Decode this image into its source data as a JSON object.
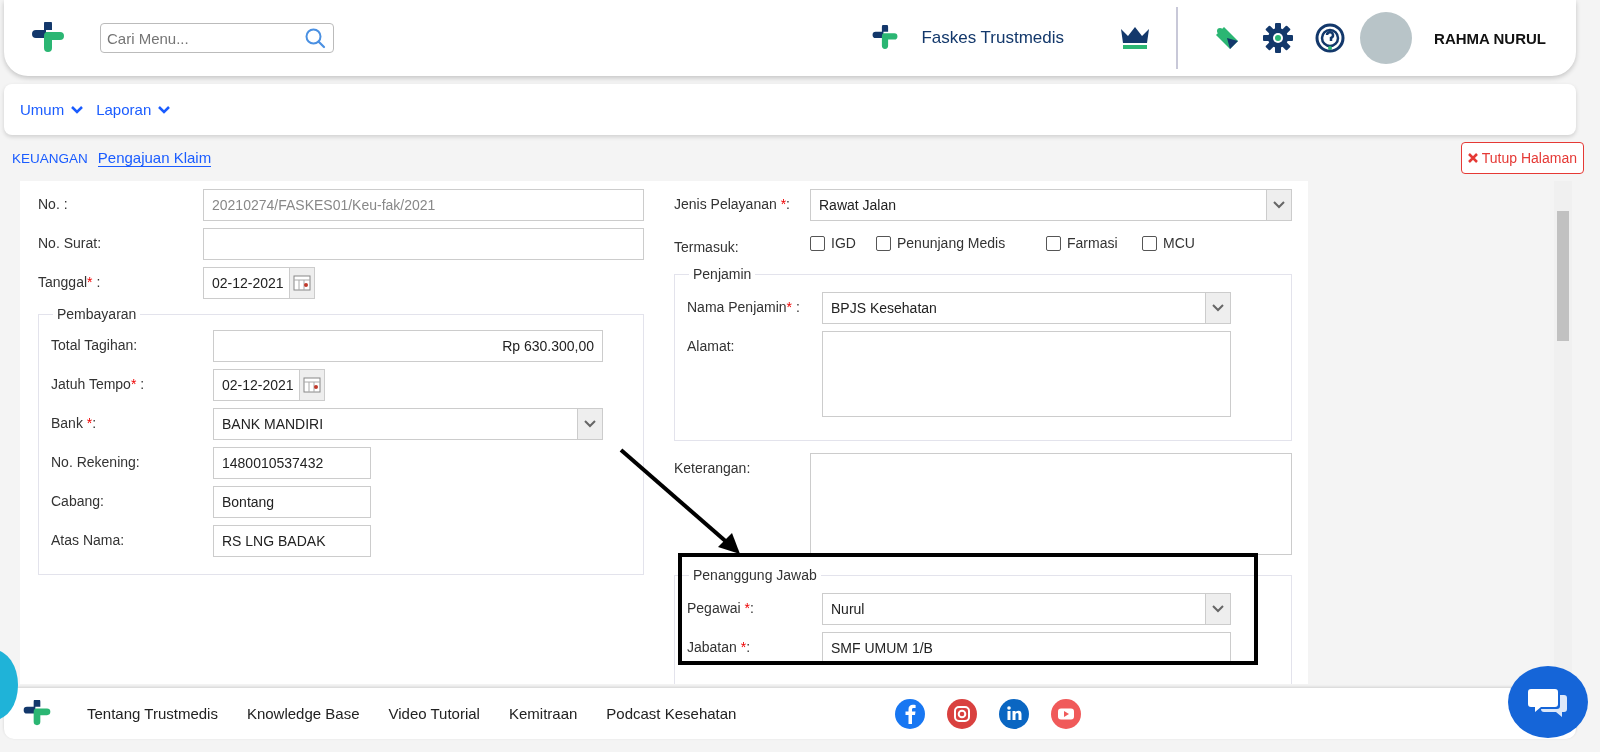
{
  "header": {
    "search": {
      "placeholder": "Cari Menu..."
    },
    "clinic": "Faskes Trustmedis",
    "user": "RAHMA NURUL"
  },
  "menu": [
    {
      "label": "Umum"
    },
    {
      "label": "Laporan"
    }
  ],
  "breadcrumb": {
    "section": "KEUANGAN",
    "page": "Pengajuan Klaim"
  },
  "close_button": "Tutup Halaman",
  "left": {
    "fields": [
      {
        "kind": "readonly",
        "label": "No.",
        "tail": " :",
        "value": "20210274/FASKES01/Keu-fak/2021"
      },
      {
        "kind": "text",
        "label": "No. Surat",
        "tail": ":"
      },
      {
        "kind": "date",
        "label": "Tanggal",
        "mark": "*",
        "tail": " :",
        "value": "02-12-2021"
      }
    ],
    "pembayaran": {
      "title": "Pembayaran",
      "fields": [
        {
          "kind": "amount",
          "label": "Total Tagihan",
          "tail": ":",
          "value": "Rp 630.300,00"
        },
        {
          "kind": "date",
          "label": "Jatuh Tempo",
          "mark": "*",
          "tail": " :",
          "value": "02-12-2021"
        },
        {
          "kind": "select",
          "label": "Bank ",
          "mark": "*",
          "tail": ":",
          "value": "BANK MANDIRI"
        },
        {
          "kind": "short",
          "label": "No. Rekening",
          "tail": ":",
          "value": "1480010537432"
        },
        {
          "kind": "short",
          "label": "Cabang",
          "tail": ":",
          "value": "Bontang"
        },
        {
          "kind": "short",
          "label": "Atas Nama",
          "tail": ":",
          "value": "RS LNG BADAK"
        }
      ]
    }
  },
  "right": {
    "jenis": {
      "kind": "select",
      "label": "Jenis Pelayanan ",
      "mark": "*",
      "tail": ":",
      "value": "Rawat Jalan"
    },
    "termasuk": {
      "label": "Termasuk:",
      "options": [
        {
          "label": "IGD",
          "checked": false
        },
        {
          "label": "Penunjang Medis",
          "checked": false
        },
        {
          "label": "Farmasi",
          "checked": false
        },
        {
          "label": "MCU",
          "checked": false
        }
      ]
    },
    "penjamin": {
      "title": "Penjamin",
      "fields": [
        {
          "kind": "select",
          "label": "Nama Penjamin",
          "mark": "*",
          "tail": " :",
          "value": "BPJS Kesehatan"
        },
        {
          "kind": "textarea",
          "label": "Alamat",
          "tail": ":"
        }
      ]
    },
    "keterangan": {
      "kind": "textarea",
      "label": "Keterangan",
      "tail": ":"
    },
    "penanggung": {
      "title": "Penanggung Jawab",
      "fields": [
        {
          "kind": "select",
          "label": "Pegawai ",
          "mark": "*",
          "tail": ":",
          "value": "Nurul"
        },
        {
          "kind": "text",
          "label": "Jabatan ",
          "mark": "*",
          "tail": ":",
          "value": "SMF UMUM 1/B"
        }
      ]
    }
  },
  "footer": {
    "links": [
      "Tentang Trustmedis",
      "Knowledge Base",
      "Video Tutorial",
      "Kemitraan",
      "Podcast Kesehatan"
    ],
    "social": [
      {
        "kind": "facebook",
        "color": "#1877f2"
      },
      {
        "kind": "instagram",
        "color": "#d9413f"
      },
      {
        "kind": "linkedin",
        "color": "#0a66c2"
      },
      {
        "kind": "youtube",
        "color": "#f05a5a"
      }
    ]
  }
}
